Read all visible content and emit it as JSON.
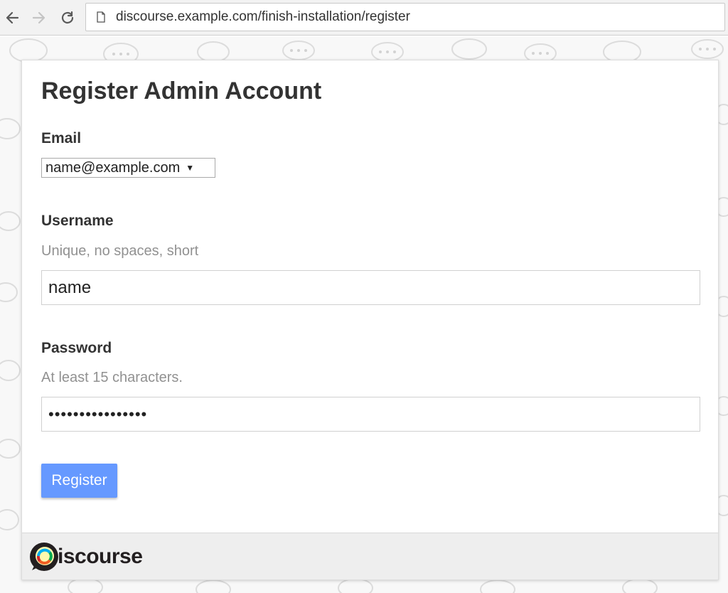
{
  "browser": {
    "url": "discourse.example.com/finish-installation/register"
  },
  "page": {
    "title": "Register Admin Account",
    "email": {
      "label": "Email",
      "selected_value": "name@example.com"
    },
    "username": {
      "label": "Username",
      "hint": "Unique, no spaces, short",
      "value": "name"
    },
    "password": {
      "label": "Password",
      "hint": "At least 15 characters.",
      "masked_value": "••••••••••••••••"
    },
    "register_button": "Register"
  },
  "footer": {
    "logo_text": "iscourse",
    "logo_alt": "Discourse"
  },
  "colors": {
    "accent_button": "#6699ff",
    "heading_text": "#333333",
    "hint_text": "#919191",
    "footer_bg": "#eeeeee"
  },
  "icons": {
    "back": "arrow-left-icon",
    "forward": "arrow-right-icon",
    "reload": "reload-icon",
    "page": "document-icon"
  }
}
